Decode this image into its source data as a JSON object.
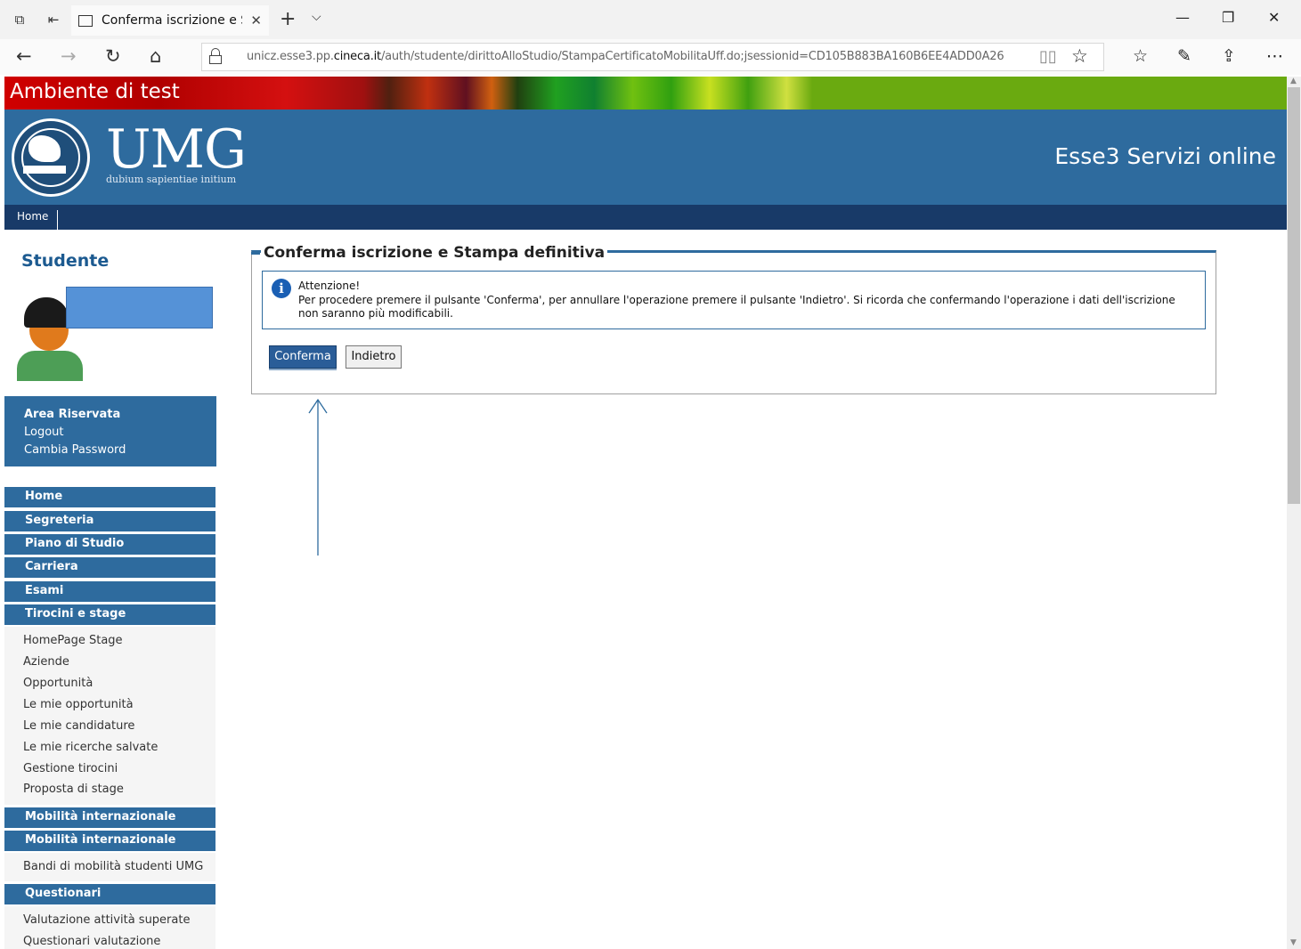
{
  "browser": {
    "tab_title": "Conferma iscrizione e S",
    "url_prefix": "unicz.esse3.pp.",
    "url_domain": "cineca.it",
    "url_path": "/auth/studente/dirittoAlloStudio/StampaCertificatoMobilitaUff.do;jsessionid=CD105B883BA160B6EE4ADD0A26"
  },
  "site": {
    "test_banner": "Ambiente di test",
    "logo_text": "UMG",
    "logo_motto": "dubium sapientiae initium",
    "service_title": "Esse3 Servizi online",
    "top_nav_home": "Home"
  },
  "sidebar": {
    "title": "Studente",
    "reserved": {
      "heading": "Area Riservata",
      "logout": "Logout",
      "change_password": "Cambia Password"
    },
    "menu": {
      "home": "Home",
      "segreteria": "Segreteria",
      "piano": "Piano di Studio",
      "carriera": "Carriera",
      "esami": "Esami",
      "tirocini": "Tirocini e stage",
      "tirocini_items": [
        "HomePage Stage",
        "Aziende",
        "Opportunità",
        "Le mie opportunità",
        "Le mie candidature",
        "Le mie ricerche salvate",
        "Gestione tirocini",
        "Proposta di stage"
      ],
      "mobilita1": "Mobilità internazionale",
      "mobilita2": "Mobilità internazionale",
      "mobilita_items": [
        "Bandi di mobilità studenti UMG"
      ],
      "questionari": "Questionari",
      "questionari_items": [
        "Valutazione attività superate",
        "Questionari valutazione"
      ]
    }
  },
  "main": {
    "section_title": "Conferma iscrizione e Stampa definitiva",
    "alert_title": "Attenzione!",
    "alert_message": "Per procedere premere il pulsante 'Conferma', per annullare l'operazione premere il pulsante 'Indietro'. Si ricorda che confermando l'operazione i dati dell'iscrizione non saranno più modificabili.",
    "confirm_label": "Conferma",
    "back_label": "Indietro"
  },
  "colors": {
    "primary_blue": "#2e6b9e",
    "dark_nav": "#183a68",
    "test_red": "#d00000",
    "test_green": "#6aaa10"
  }
}
